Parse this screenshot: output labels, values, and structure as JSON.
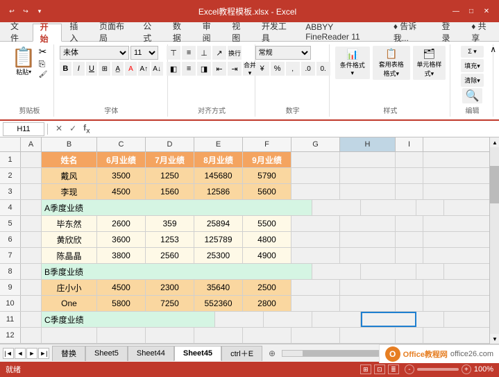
{
  "titleBar": {
    "title": "Excel教程模板.xlsx - Excel",
    "quickAccess": [
      "↩",
      "↪",
      "▾"
    ],
    "windowButtons": [
      "—",
      "□",
      "✕"
    ]
  },
  "ribbonTabs": [
    "文件",
    "开始",
    "插入",
    "页面布局",
    "公式",
    "数据",
    "审阅",
    "视图",
    "开发工具",
    "ABBYY FineReader 11",
    "♦ 告诉我...",
    "登录",
    "♦ 共享"
  ],
  "activeTab": "开始",
  "groups": {
    "clipboard": "剪贴板",
    "font": "字体",
    "alignment": "对齐方式",
    "number": "数字",
    "style": "样式",
    "editing": "编辑"
  },
  "fontControls": {
    "fontFamily": "未体",
    "fontSize": "11",
    "fontSizeUnit": "▾"
  },
  "formulaBar": {
    "cellRef": "H11",
    "formula": ""
  },
  "columns": [
    "A",
    "B",
    "C",
    "D",
    "E",
    "F",
    "G",
    "H",
    "I"
  ],
  "rows": [
    {
      "rowNum": 1,
      "cells": [
        "",
        "姓名",
        "6月业绩",
        "7月业绩",
        "8月业绩",
        "9月业绩",
        "",
        "",
        ""
      ]
    },
    {
      "rowNum": 2,
      "cells": [
        "",
        "戴风",
        "3500",
        "1250",
        "145680",
        "5790",
        "",
        "",
        ""
      ]
    },
    {
      "rowNum": 3,
      "cells": [
        "",
        "李现",
        "4500",
        "1560",
        "12586",
        "5600",
        "",
        "",
        ""
      ]
    },
    {
      "rowNum": 4,
      "cells": [
        "",
        "A季度业绩",
        "",
        "",
        "",
        "",
        "",
        "",
        ""
      ]
    },
    {
      "rowNum": 5,
      "cells": [
        "",
        "毕东然",
        "2600",
        "359",
        "25894",
        "5500",
        "",
        "",
        ""
      ]
    },
    {
      "rowNum": 6,
      "cells": [
        "",
        "黄欣欣",
        "3600",
        "1253",
        "125789",
        "4800",
        "",
        "",
        ""
      ]
    },
    {
      "rowNum": 7,
      "cells": [
        "",
        "陈晶晶",
        "3800",
        "2560",
        "25300",
        "4900",
        "",
        "",
        ""
      ]
    },
    {
      "rowNum": 8,
      "cells": [
        "",
        "B季度业绩",
        "",
        "",
        "",
        "",
        "",
        "",
        ""
      ]
    },
    {
      "rowNum": 9,
      "cells": [
        "",
        "庄小小",
        "4500",
        "2300",
        "35640",
        "2500",
        "",
        "",
        ""
      ]
    },
    {
      "rowNum": 10,
      "cells": [
        "",
        "One",
        "5800",
        "7250",
        "552360",
        "2800",
        "",
        "",
        ""
      ]
    },
    {
      "rowNum": 11,
      "cells": [
        "",
        "C季度业绩",
        "",
        "",
        "",
        "",
        "",
        "",
        ""
      ]
    },
    {
      "rowNum": 12,
      "cells": [
        "",
        "",
        "",
        "",
        "",
        "",
        "",
        "",
        ""
      ]
    }
  ],
  "sheetTabs": [
    "替换",
    "Sheet5",
    "Sheet44",
    "Sheet45",
    "ctrl＋E"
  ],
  "activeSheet": "Sheet45",
  "statusBar": {
    "status": "就绪",
    "zoom": "100%"
  }
}
